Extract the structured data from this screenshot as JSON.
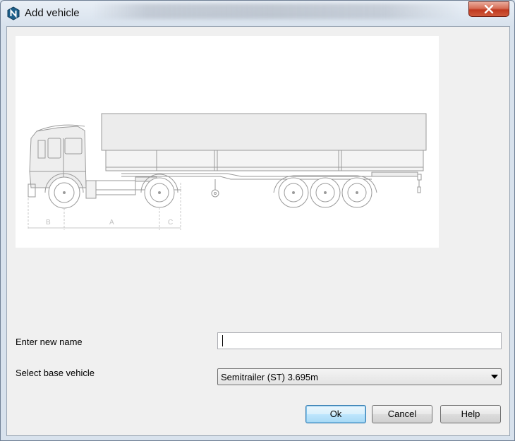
{
  "window": {
    "title": "Add vehicle",
    "close_label": "✕"
  },
  "preview": {
    "dimension_labels": [
      "B",
      "A",
      "C"
    ]
  },
  "form": {
    "name_label": "Enter new name",
    "name_value": "",
    "base_label": "Select base vehicle",
    "base_selected": "Semitrailer (ST) 3.695m"
  },
  "buttons": {
    "ok": "Ok",
    "cancel": "Cancel",
    "help": "Help"
  },
  "colors": {
    "titlebar": "#d8e2ed",
    "close_button": "#c0391f",
    "default_button_border": "#3c7fb1",
    "app_icon": "#1e5f8a"
  },
  "icons": {
    "app": "n-hexagon-icon",
    "close": "close-icon",
    "dropdown": "chevron-down-icon"
  }
}
